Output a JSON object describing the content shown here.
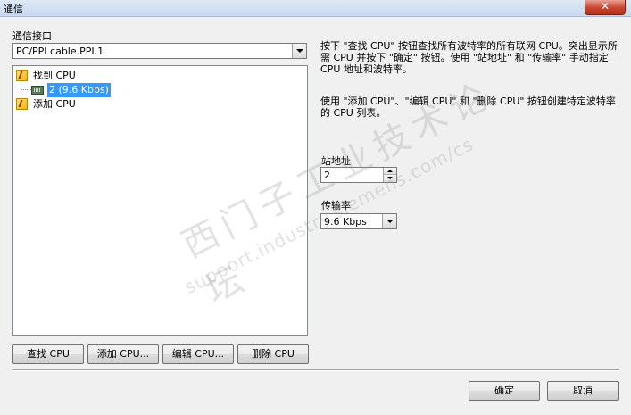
{
  "window": {
    "title": "通信",
    "close_symbol": "✕"
  },
  "port": {
    "label": "通信接口",
    "value": "PC/PPI cable.PPI.1"
  },
  "tree": {
    "found_cpu": "找到 CPU",
    "device": "2 (9.6 Kbps)",
    "add_cpu": "添加 CPU"
  },
  "buttons": {
    "find_cpu": "查找 CPU",
    "add_cpu": "添加 CPU...",
    "edit_cpu": "编辑 CPU...",
    "delete_cpu": "删除 CPU",
    "ok": "确定",
    "cancel": "取消"
  },
  "help": {
    "text1": "按下 \"查找 CPU\" 按钮查找所有波特率的所有联网 CPU。突出显示所需 CPU 并按下 \"确定\" 按钮。使用 \"站地址\" 和 \"传输率\" 手动指定 CPU 地址和波特率。",
    "text2": "使用 \"添加 CPU\"、\"编辑 CPU\" 和 \"删除 CPU\" 按钮创建特定波特率的 CPU 列表。"
  },
  "station": {
    "label": "站地址",
    "value": "2"
  },
  "baud": {
    "label": "传输率",
    "value": "9.6 Kbps"
  },
  "watermark": {
    "line1": "西门子工业技术论坛",
    "line2": "support.industry.siemens.com/cs"
  }
}
